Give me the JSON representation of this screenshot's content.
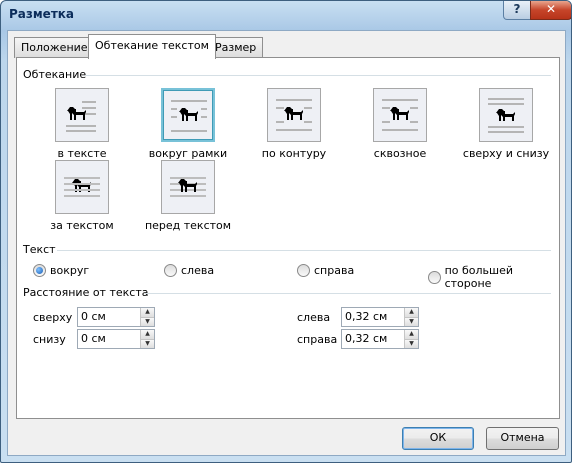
{
  "window": {
    "title": "Разметка",
    "help_label": "?",
    "close_label": "✕"
  },
  "tabs": [
    {
      "label": "Положение"
    },
    {
      "label": "Обтекание текстом"
    },
    {
      "label": "Размер"
    }
  ],
  "wrapping": {
    "heading": "Обтекание",
    "options": [
      {
        "label": "в тексте",
        "icon": "inline-wrap-icon",
        "selected": false
      },
      {
        "label": "вокруг рамки",
        "icon": "square-wrap-icon",
        "selected": true
      },
      {
        "label": "по контуру",
        "icon": "tight-wrap-icon",
        "selected": false
      },
      {
        "label": "сквозное",
        "icon": "through-wrap-icon",
        "selected": false
      },
      {
        "label": "сверху и снизу",
        "icon": "top-bottom-wrap-icon",
        "selected": false
      },
      {
        "label": "за текстом",
        "icon": "behind-text-icon",
        "selected": false
      },
      {
        "label": "перед текстом",
        "icon": "in-front-text-icon",
        "selected": false
      }
    ]
  },
  "text": {
    "heading": "Текст",
    "options": [
      {
        "label": "вокруг",
        "checked": true
      },
      {
        "label": "слева",
        "checked": false
      },
      {
        "label": "справа",
        "checked": false
      },
      {
        "label": "по большей стороне",
        "checked": false
      }
    ]
  },
  "distance": {
    "heading": "Расстояние от текста",
    "top": {
      "label": "сверху",
      "value": "0 см"
    },
    "bottom": {
      "label": "снизу",
      "value": "0 см"
    },
    "left": {
      "label": "слева",
      "value": "0,32 см"
    },
    "right": {
      "label": "справа",
      "value": "0,32 см"
    }
  },
  "buttons": {
    "ok": "ОК",
    "cancel": "Отмена"
  },
  "colors": {
    "selection": "#78c2d8",
    "title_text": "#0c2d5b",
    "close_button": "#c6452a"
  }
}
